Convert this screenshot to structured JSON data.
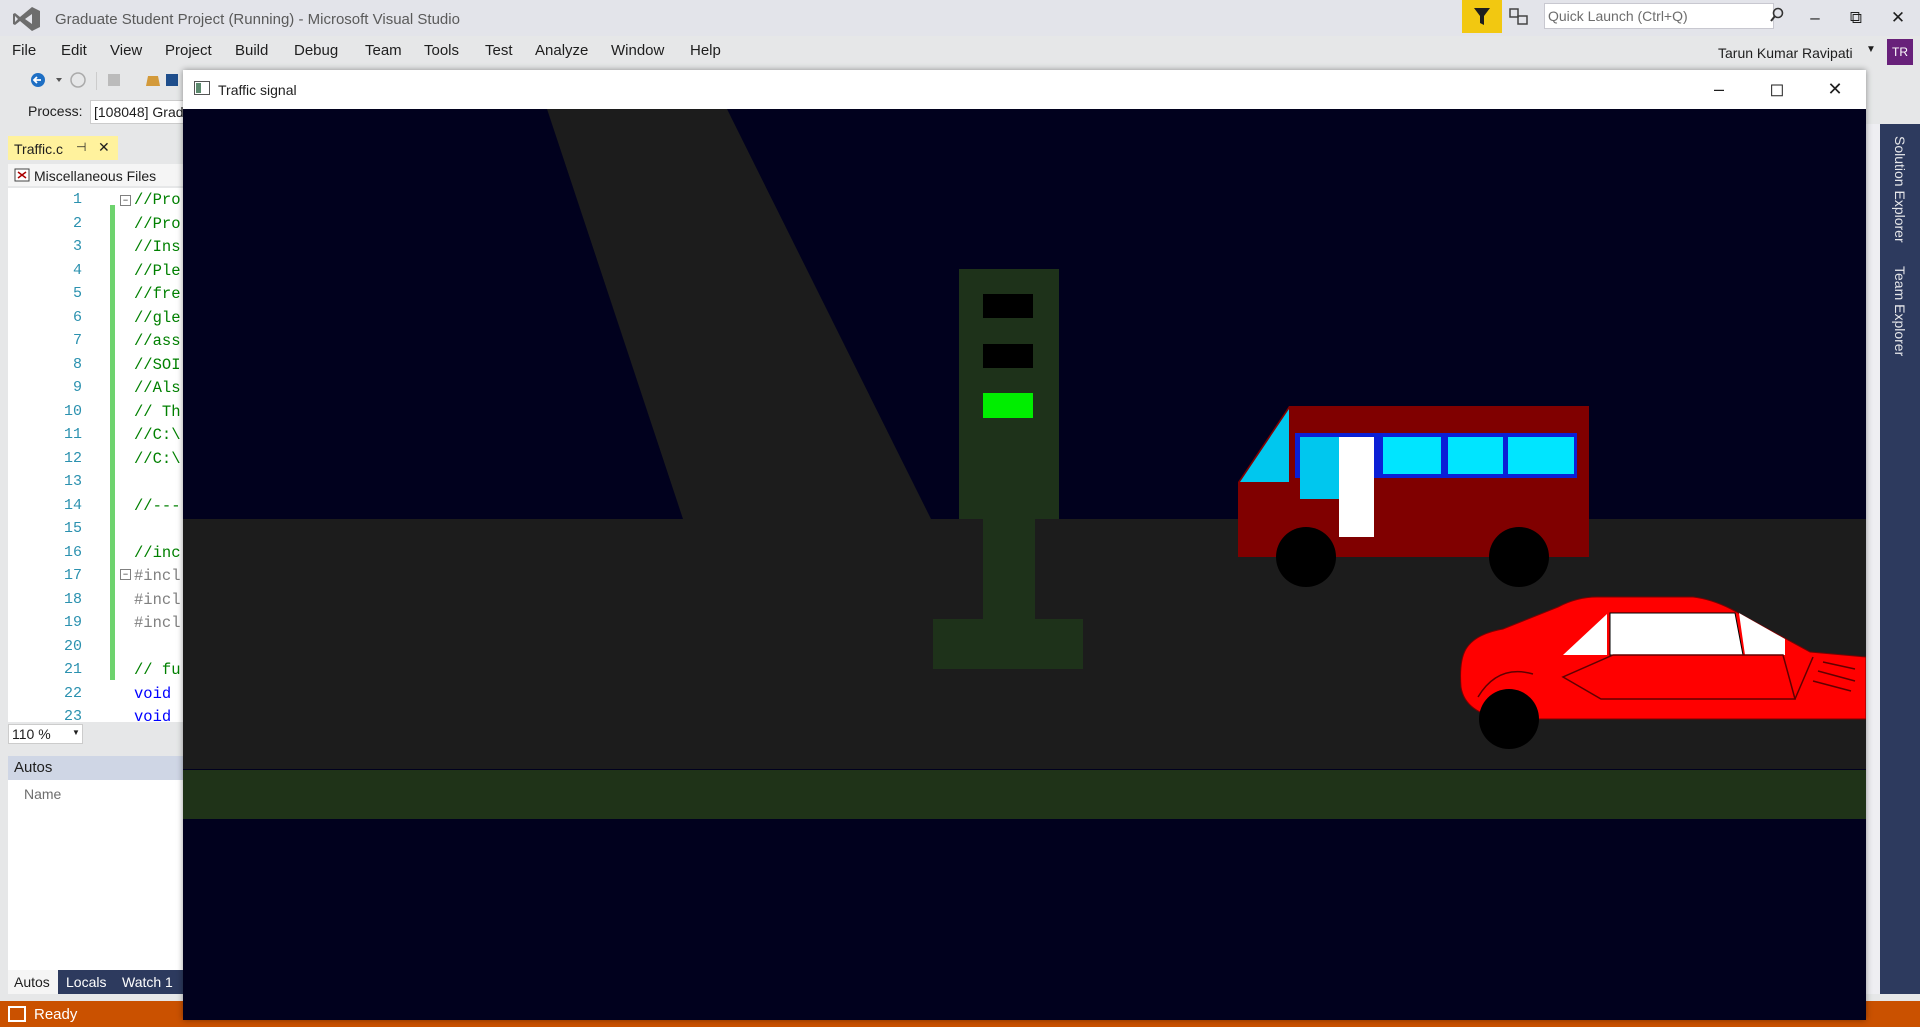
{
  "vs": {
    "title": "Graduate Student Project (Running) - Microsoft Visual Studio",
    "quick_launch_placeholder": "Quick Launch (Ctrl+Q)",
    "user_name": "Tarun Kumar Ravipati",
    "user_initials": "TR",
    "menu": [
      "File",
      "Edit",
      "View",
      "Project",
      "Build",
      "Debug",
      "Team",
      "Tools",
      "Test",
      "Analyze",
      "Window",
      "Help"
    ],
    "process_label": "Process:",
    "process_value": "[108048] Grad"
  },
  "editor": {
    "tab_label": "Traffic.c",
    "tab_pin": "⊣",
    "tab_close": "✕",
    "nav_label": "Miscellaneous Files",
    "zoom": "110 %",
    "line_numbers": [
      "1",
      "2",
      "3",
      "4",
      "5",
      "6",
      "7",
      "8",
      "9",
      "10",
      "11",
      "12",
      "13",
      "14",
      "15",
      "16",
      "17",
      "18",
      "19",
      "20",
      "21",
      "22",
      "23"
    ],
    "lines": [
      {
        "text": "//Pro",
        "cls": "cm"
      },
      {
        "text": "//Pro",
        "cls": "cm"
      },
      {
        "text": "//Ins",
        "cls": "cm"
      },
      {
        "text": "//Ple",
        "cls": "cm"
      },
      {
        "text": "//fre",
        "cls": "cm"
      },
      {
        "text": "//gle",
        "cls": "cm"
      },
      {
        "text": "//ass",
        "cls": "cm"
      },
      {
        "text": "//SOI",
        "cls": "cm"
      },
      {
        "text": "//Als",
        "cls": "cm"
      },
      {
        "text": "// Th",
        "cls": "cm"
      },
      {
        "text": "//C:\\",
        "cls": "cm"
      },
      {
        "text": "//C:\\",
        "cls": "cm"
      },
      {
        "text": "",
        "cls": "cm"
      },
      {
        "text": "//---",
        "cls": "cm"
      },
      {
        "text": "",
        "cls": "cm"
      },
      {
        "text": "//inc",
        "cls": "cm"
      },
      {
        "text": "#incl",
        "cls": "pp"
      },
      {
        "text": "#incl",
        "cls": "pp"
      },
      {
        "text": "#incl",
        "cls": "pp"
      },
      {
        "text": "",
        "cls": "cm"
      },
      {
        "text": "// fu",
        "cls": "cm"
      },
      {
        "text": "void",
        "cls": "kw"
      },
      {
        "text": "void",
        "cls": "kw"
      }
    ]
  },
  "autos": {
    "title": "Autos",
    "column_name": "Name",
    "tabs": [
      "Autos",
      "Locals",
      "Watch 1"
    ]
  },
  "right_dock": [
    "Solution Explorer",
    "Team Explorer"
  ],
  "status": {
    "text": "Ready",
    "color": "#ca5100"
  },
  "traffic_window": {
    "title": "Traffic signal",
    "signal_lights": {
      "red": "off",
      "yellow": "off",
      "green": "on"
    },
    "colors": {
      "sky": "#01011e",
      "road": "#1c1c1c",
      "grass": "#1f3318",
      "signal": "#1e321a",
      "bus": "#800000",
      "car": "#ff0000",
      "green_light": "#00ee00",
      "bus_window": "#00e5ff"
    }
  }
}
